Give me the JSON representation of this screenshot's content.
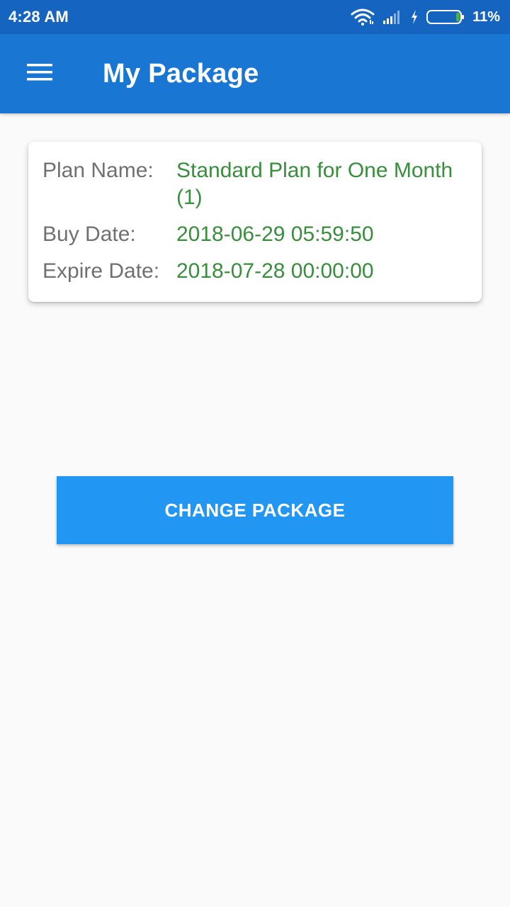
{
  "status_bar": {
    "time": "4:28 AM",
    "battery_percent": "11%",
    "icons": [
      "wifi-icon",
      "signal-icon",
      "charging-icon",
      "battery-icon"
    ],
    "battery_level": 0.11
  },
  "app_bar": {
    "menu_icon": "hamburger-menu-icon",
    "title": "My Package"
  },
  "package_card": {
    "rows": [
      {
        "label": "Plan Name:",
        "value": "Standard Plan for One Month (1)"
      },
      {
        "label": "Buy Date:",
        "value": "2018-06-29 05:59:50"
      },
      {
        "label": "Expire Date:",
        "value": "2018-07-28 00:00:00"
      }
    ]
  },
  "actions": {
    "change_package_label": "CHANGE PACKAGE"
  },
  "colors": {
    "status_bar": "#1565c0",
    "app_bar": "#1976d2",
    "button": "#2196f3",
    "value_text": "#388e3c",
    "label_text": "#707070",
    "background": "#fafafa"
  }
}
